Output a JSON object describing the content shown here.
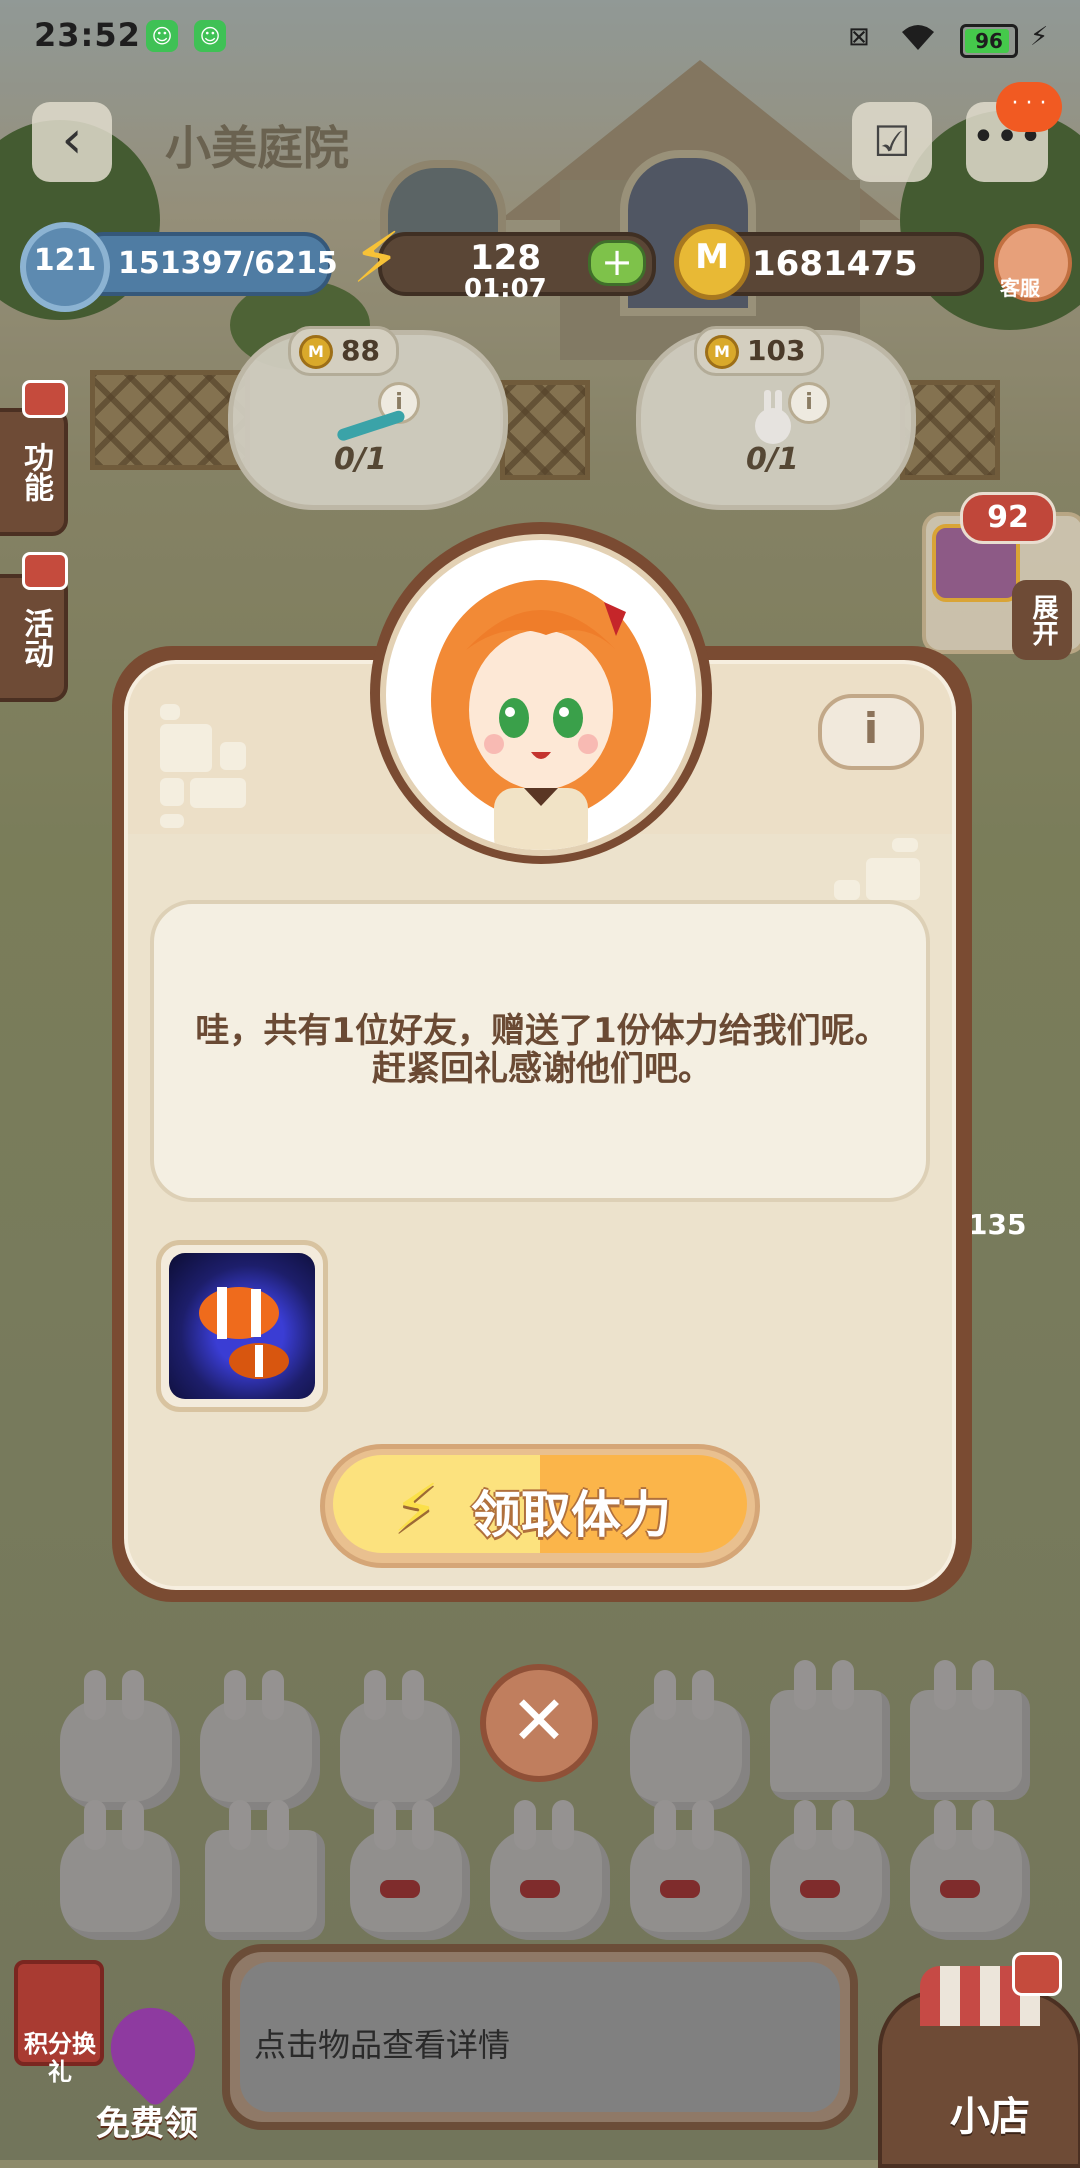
{
  "status_bar": {
    "time": "23:52",
    "battery": "96",
    "icons": [
      "app-notification-icon",
      "app-notification-icon",
      "sim-off-icon",
      "wifi-icon",
      "battery-icon",
      "charging-icon"
    ]
  },
  "header": {
    "title": "小美庭院",
    "back_icon": "back-arrow-icon",
    "check_icon": "check-icon",
    "more_icon": "more-icon",
    "notification_dot": "· · ·"
  },
  "resources": {
    "level": "121",
    "xp": "151397/6215",
    "energy": "128",
    "energy_timer": "01:07",
    "plus": "+",
    "coins": "1681475",
    "coin_symbol": "M",
    "customer_service": "客服"
  },
  "orders": [
    {
      "price": "88",
      "progress": "0/1",
      "info": "i"
    },
    {
      "price": "103",
      "progress": "0/1",
      "info": "i"
    }
  ],
  "side_tabs": {
    "function": "功能",
    "activity": "活动",
    "expand": "展开",
    "chest_count": "92",
    "side_number": "135"
  },
  "dialog": {
    "info_label": "i",
    "message": "哇，共有1位好友，赠送了1份体力给我们呢。赶紧回礼感谢他们吧。",
    "claim_button": "领取体力",
    "close_label": "✕"
  },
  "bottom_bar": {
    "points_label": "积分换礼",
    "free_label": "免费领",
    "tip": "点击物品查看详情",
    "shop_label": "小店"
  },
  "colors": {
    "modal_frame": "#7a4b32",
    "modal_bg": "#ecdfc7",
    "claim_yellow": "#fce27e",
    "claim_orange": "#fbb54a",
    "energy": "#f7c237",
    "coin": "#e8b935"
  }
}
